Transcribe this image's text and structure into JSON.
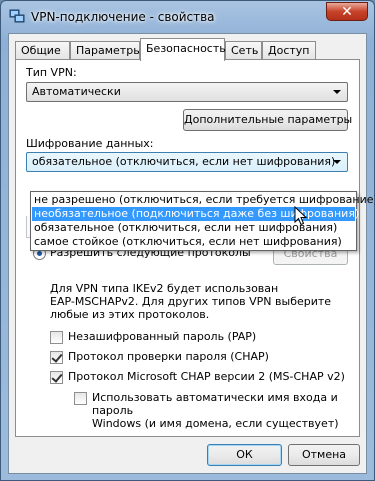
{
  "window": {
    "title": "VPN-подключение - свойства",
    "close_glyph": "✕",
    "icon": "network-icon"
  },
  "tabs": [
    "Общие",
    "Параметры",
    "Безопасность",
    "Сеть",
    "Доступ"
  ],
  "active_tab": "Безопасность",
  "vpn_type": {
    "label": "Тип VPN:",
    "value": "Автоматически"
  },
  "advanced_button": "Дополнительные параметры",
  "encryption": {
    "label": "Шифрование данных:",
    "value": "обязательное (отключиться, если нет шифрования)",
    "options": [
      "не разрешено (отключиться, если требуется шифрование)",
      "необязательное (подключиться даже без шифрования)",
      "обязательное (отключиться, если нет шифрования)",
      "самое стойкое (отключиться, если нет шифрования)"
    ],
    "highlighted_index": 1
  },
  "protocols_radio": "Разрешить следующие протоколы",
  "properties_button": "Свойства",
  "info_text": [
    "Для VPN типа IKEv2 будет использован",
    "EAP-MSCHAPv2. Для других типов VPN выберите",
    "любые из этих протоколов."
  ],
  "checkboxes": {
    "pap": {
      "label": "Незашифрованный пароль (PAP)",
      "checked": false
    },
    "chap": {
      "label": "Протокол проверки пароля (CHAP)",
      "checked": true
    },
    "mschap": {
      "label": "Протокол Microsoft CHAP версии 2 (MS-CHAP v2)",
      "checked": true
    },
    "autologon": {
      "label_line1": "Использовать автоматически имя входа и пароль",
      "label_line2": "Windows (и имя домена, если существует)",
      "checked": false
    }
  },
  "ok_button": "ОК",
  "cancel_button": "Отмена",
  "colors": {
    "selection": "#3399ff",
    "close": "#c7432a"
  }
}
